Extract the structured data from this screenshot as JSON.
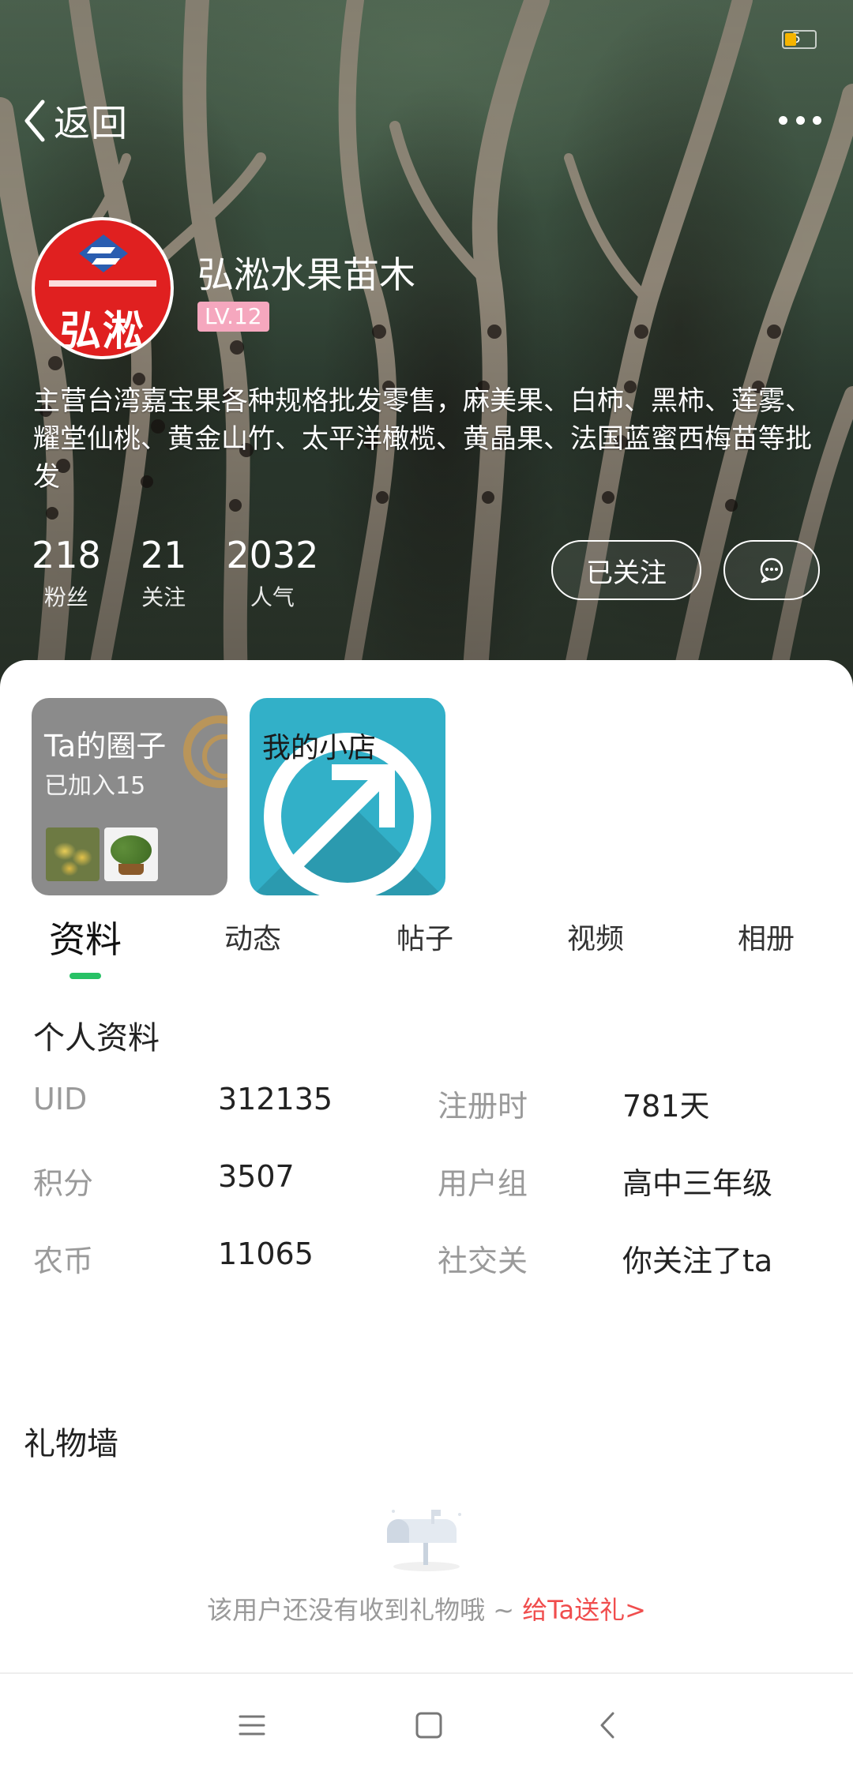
{
  "header": {
    "back_label": "返回",
    "username": "弘淞水果苗木",
    "level": "LV.12",
    "avatar_text": "弘淞",
    "bio": "主营台湾嘉宝果各种规格批发零售，麻美果、白柿、黑柿、莲雾、耀堂仙桃、黄金山竹、太平洋橄榄、黄晶果、法国蓝蜜西梅苗等批发",
    "stats": [
      {
        "value": "218",
        "label": "粉丝"
      },
      {
        "value": "21",
        "label": "关注"
      },
      {
        "value": "2032",
        "label": "人气"
      }
    ],
    "follow_label": "已关注"
  },
  "cards": {
    "circle": {
      "title": "Ta的圈子",
      "subtitle": "已加入15"
    },
    "shop": {
      "title": "我的小店"
    }
  },
  "tabs": [
    {
      "label": "资料",
      "active": true
    },
    {
      "label": "动态"
    },
    {
      "label": "帖子"
    },
    {
      "label": "视频"
    },
    {
      "label": "相册"
    }
  ],
  "profile": {
    "title": "个人资料",
    "rows": [
      {
        "k1": "UID",
        "v1": "312135",
        "k2": "注册时",
        "v2": "781天"
      },
      {
        "k1": "积分",
        "v1": "3507",
        "k2": "用户组",
        "v2": "高中三年级"
      },
      {
        "k1": "农币",
        "v1": "11065",
        "k2": "社交关",
        "v2": "你关注了ta"
      }
    ]
  },
  "gifts": {
    "title": "礼物墙",
    "empty_text": "该用户还没有收到礼物哦 ~ ",
    "link_text": "给Ta送礼>"
  },
  "colors": {
    "accent_green": "#27c165",
    "level_pink": "#f5a7be",
    "link_red": "#f04d4d",
    "shop_blue": "#32b0c8"
  }
}
